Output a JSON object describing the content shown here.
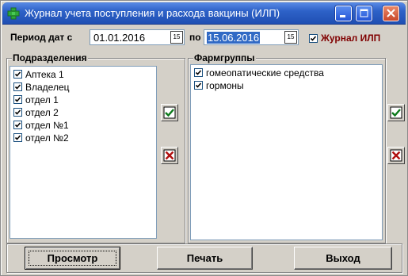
{
  "window": {
    "title": "Журнал учета поступления и расхода вакцины (ИЛП)",
    "icon": "green-cross-icon"
  },
  "period": {
    "label": "Период дат с",
    "from_value": "01.01.2016",
    "to_label": "по",
    "to_value": "15.06.2016",
    "calendar_glyph": "15",
    "journal_checkbox_label": "Журнал ИЛП",
    "journal_checked": true,
    "journal_label_color": "#800000"
  },
  "departments": {
    "caption": "Подразделения",
    "items": [
      {
        "label": "Аптека 1",
        "checked": true
      },
      {
        "label": "Владелец",
        "checked": true
      },
      {
        "label": "отдел 1",
        "checked": true
      },
      {
        "label": "отдел 2",
        "checked": true
      },
      {
        "label": "отдел №1",
        "checked": true
      },
      {
        "label": "отдел №2",
        "checked": true
      }
    ]
  },
  "pharmgroups": {
    "caption": "Фармгруппы",
    "items": [
      {
        "label": "гомеопатические средства",
        "checked": true
      },
      {
        "label": "гормоны",
        "checked": true
      }
    ]
  },
  "buttons": {
    "view": "Просмотр",
    "print": "Печать",
    "exit": "Выход"
  }
}
